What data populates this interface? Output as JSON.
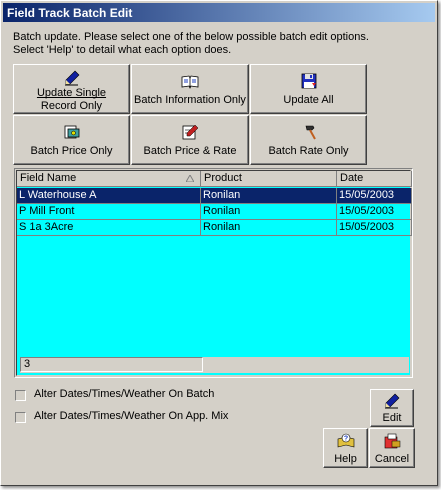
{
  "window": {
    "title": "Field Track Batch Edit"
  },
  "intro": {
    "line1": "Batch update. Please select one of the below possible batch edit options.",
    "line2": "Select 'Help' to detail what each option does."
  },
  "buttons": {
    "update_single_line1": "Update Single",
    "update_single_line2": "Record Only",
    "batch_information": "Batch Information Only",
    "update_all": "Update All",
    "batch_price": "Batch Price Only",
    "batch_price_rate": "Batch Price & Rate",
    "batch_rate": "Batch Rate Only",
    "edit": "Edit",
    "help": "Help",
    "cancel": "Cancel"
  },
  "table": {
    "columns": [
      "Field Name",
      "Product",
      "Date"
    ],
    "rows": [
      {
        "field": "L Waterhouse A",
        "product": "Ronilan",
        "date": "15/05/2003",
        "selected": true
      },
      {
        "field": "P Mill Front",
        "product": "Ronilan",
        "date": "15/05/2003",
        "selected": false
      },
      {
        "field": "S 1a 3Acre",
        "product": "Ronilan",
        "date": "15/05/2003",
        "selected": false
      }
    ],
    "footer_count": "3"
  },
  "options": {
    "alter_on_batch": "Alter Dates/Times/Weather On Batch",
    "alter_on_mix": "Alter Dates/Times/Weather On App. Mix"
  },
  "icons": {
    "update_single": "pen-icon",
    "batch_information": "open-book-icon",
    "update_all": "floppy-disk-icon",
    "batch_price": "price-document-icon",
    "batch_price_rate": "edit-document-icon",
    "batch_rate": "hammer-icon",
    "edit": "pen-icon",
    "help": "help-icon",
    "cancel": "cancel-icon"
  },
  "colors": {
    "title_start": "#0a246a",
    "title_end": "#a6caf0",
    "grid_background": "#00ffff",
    "selection": "#0a246a"
  }
}
